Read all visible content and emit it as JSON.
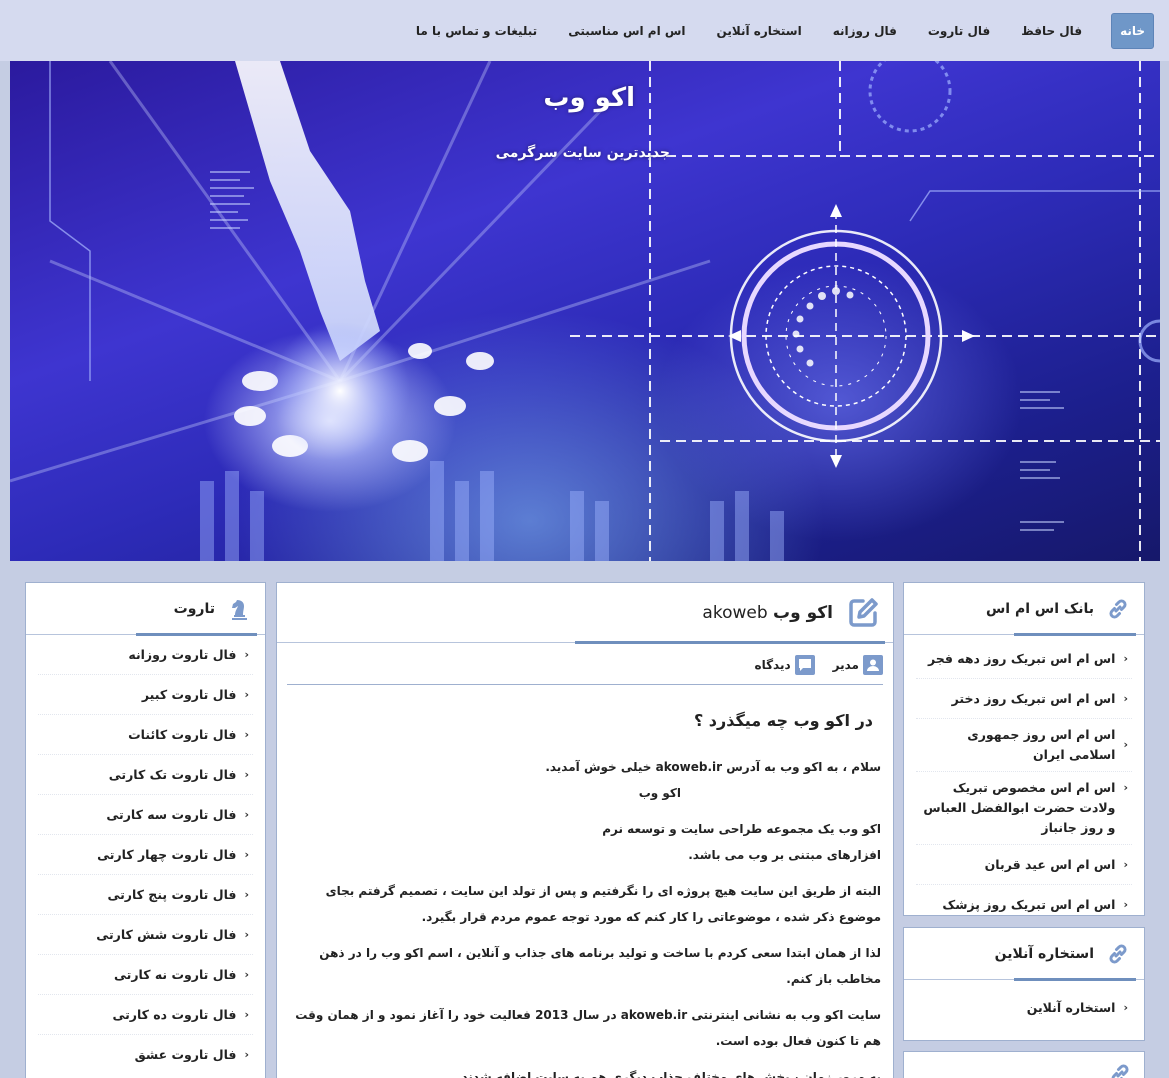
{
  "nav": {
    "items": [
      "خانه",
      "فال حافظ",
      "فال تاروت",
      "فال روزانه",
      "استخاره آنلاین",
      "اس ام اس مناسبتی",
      "تبلیغات و تماس با ما"
    ]
  },
  "hero": {
    "title": "اکو وب",
    "tagline": "جدیدترین سایت سرگرمی"
  },
  "right_sidebar": {
    "sms_bank": {
      "title": "بانک اس ام اس",
      "icon": "link-icon",
      "items": [
        "اس ام اس تبریک روز دهه فجر",
        "اس ام اس تبریک روز دختر",
        "اس ام اس روز جمهوری اسلامی ایران",
        "اس ام اس مخصوص تبریک ولادت حضرت ابوالفضل العباس و روز جانباز",
        "اس ام اس عید قربان",
        "اس ام اس تبریک روز پزشک"
      ]
    },
    "istikhara": {
      "title": "استخاره آنلاین",
      "icon": "link-icon",
      "items": [
        "استخاره آنلاین"
      ]
    }
  },
  "article": {
    "title_fa": "اکو وب",
    "title_en": "akoweb",
    "icon": "edit-icon",
    "author": "مدیر",
    "comments": "دیدگاه",
    "heading": "در اکو وب چه میگذرد ؟",
    "p1": "سلام ، به اکو وب به آدرس akoweb.ir خیلی خوش آمدید.",
    "p1b": "اکو وب",
    "p2": "اکو وب یک مجموعه طراحی سایت و توسعه نرم افزارهای مبتنی بر وب می باشد.",
    "p3": "البته از طریق این سایت هیچ پروژه ای را نگرفتیم و پس از تولد این سایت ، تصمیم گرفتم بجای موضوع ذکر شده ، موضوعاتی را کار کنم که مورد توجه عموم مردم قرار بگیرد.",
    "p4": "لذا از همان ابتدا سعی کردم با ساخت و تولید برنامه های جذاب و آنلاین ، اسم اکو وب را در ذهن مخاطب باز کنم.",
    "p5": "سایت اکو وب به نشانی اینترنتی akoweb.ir در سال 2013 فعالیت خود را آغاز نمود و از همان وقت هم تا کنون فعال بوده است.",
    "p6": "به مرور زمان ، بخش های مختلف جذاب دیگری هم به سایت اضافه شدند."
  },
  "left_sidebar": {
    "tarot": {
      "title": "تاروت",
      "icon": "chess-knight-icon",
      "items": [
        "فال تاروت روزانه",
        "فال تاروت کبیر",
        "فال تاروت کائنات",
        "فال تاروت تک کارتی",
        "فال تاروت سه کارتی",
        "فال تاروت چهار کارتی",
        "فال تاروت پنج کارتی",
        "فال تاروت شش کارتی",
        "فال تاروت نه کارتی",
        "فال تاروت ده کارتی",
        "فال تاروت عشق"
      ]
    }
  },
  "colors": {
    "accent": "#6f97c8",
    "nav_bg": "#d5daef",
    "page_bg": "#c5cde3",
    "icon": "#7c9acb"
  }
}
